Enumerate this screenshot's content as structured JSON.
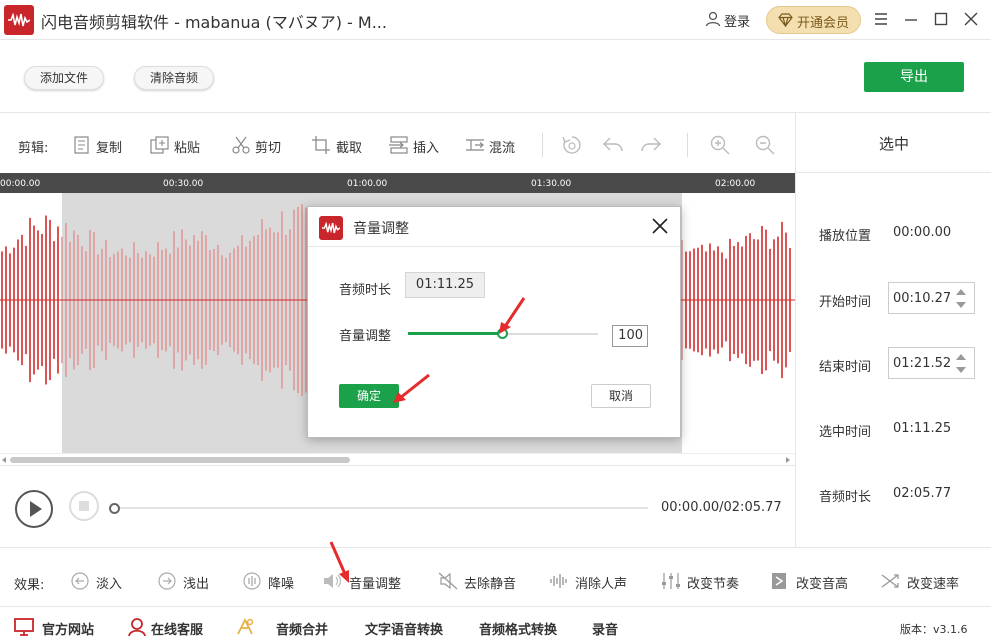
{
  "window": {
    "title": "闪电音频剪辑软件 - mabanua (マバヌア) - M...",
    "login_label": "登录",
    "vip_label": "开通会员"
  },
  "topbar": {
    "add_file": "添加文件",
    "clear_audio": "清除音频",
    "export": "导出"
  },
  "edit_toolbar": {
    "label": "剪辑:",
    "copy": "复制",
    "paste": "粘贴",
    "cut": "剪切",
    "crop": "截取",
    "insert": "插入",
    "mix": "混流"
  },
  "ruler": {
    "ticks": [
      "00:00.00",
      "00:30.00",
      "01:00.00",
      "01:30.00",
      "02:00.00"
    ]
  },
  "player": {
    "time_readout": "00:00.00/02:05.77"
  },
  "right_panel": {
    "title": "选中",
    "play_position_label": "播放位置",
    "play_position_value": "00:00.00",
    "start_time_label": "开始时间",
    "start_time_value": "00:10.27",
    "end_time_label": "结束时间",
    "end_time_value": "01:21.52",
    "selected_time_label": "选中时间",
    "selected_time_value": "01:11.25",
    "audio_duration_label": "音频时长",
    "audio_duration_value": "02:05.77"
  },
  "effects": {
    "label": "效果:",
    "items": [
      "淡入",
      "浅出",
      "降噪",
      "音量调整",
      "去除静音",
      "消除人声",
      "改变节奏",
      "改变音高",
      "改变速率"
    ]
  },
  "bottombar": {
    "official_site": "官方网站",
    "online_service": "在线客服",
    "audio_merge": "音频合并",
    "tts": "文字语音转换",
    "format_convert": "音频格式转换",
    "record": "录音",
    "version": "版本：v3.1.6"
  },
  "dialog": {
    "title": "音量调整",
    "duration_label": "音频时长",
    "duration_value": "01:11.25",
    "volume_label": "音量调整",
    "volume_value": "100",
    "volume_fraction": 0.5,
    "ok": "确定",
    "cancel": "取消"
  },
  "colors": {
    "accent_green": "#1aa14a",
    "brand_red": "#c9262b",
    "waveform_red": "#d42a2a",
    "waveform_selected": "#e09a9a"
  }
}
